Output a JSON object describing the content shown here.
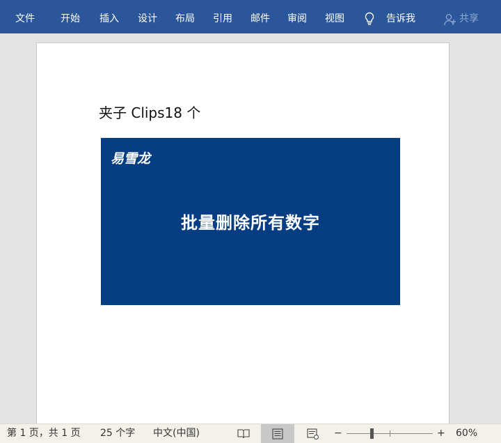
{
  "ribbon": {
    "tabs": [
      "文件",
      "开始",
      "插入",
      "设计",
      "布局",
      "引用",
      "邮件",
      "审阅",
      "视图"
    ],
    "tell_me": "告诉我",
    "share": "共享"
  },
  "document": {
    "lines": [
      "夹子 Clips18 个"
    ]
  },
  "overlay": {
    "logo": "易雪龙",
    "title": "批量删除所有数字",
    "background": "#043d82"
  },
  "statusbar": {
    "page_info": "第 1 页，共 1 页",
    "word_count": "25 个字",
    "language": "中文(中国)",
    "zoom_minus": "−",
    "zoom_plus": "+",
    "zoom_level": "60%"
  },
  "colors": {
    "ribbon": "#2b579a",
    "canvas": "#e3e3e3",
    "statusbar": "#f3f1ea"
  }
}
